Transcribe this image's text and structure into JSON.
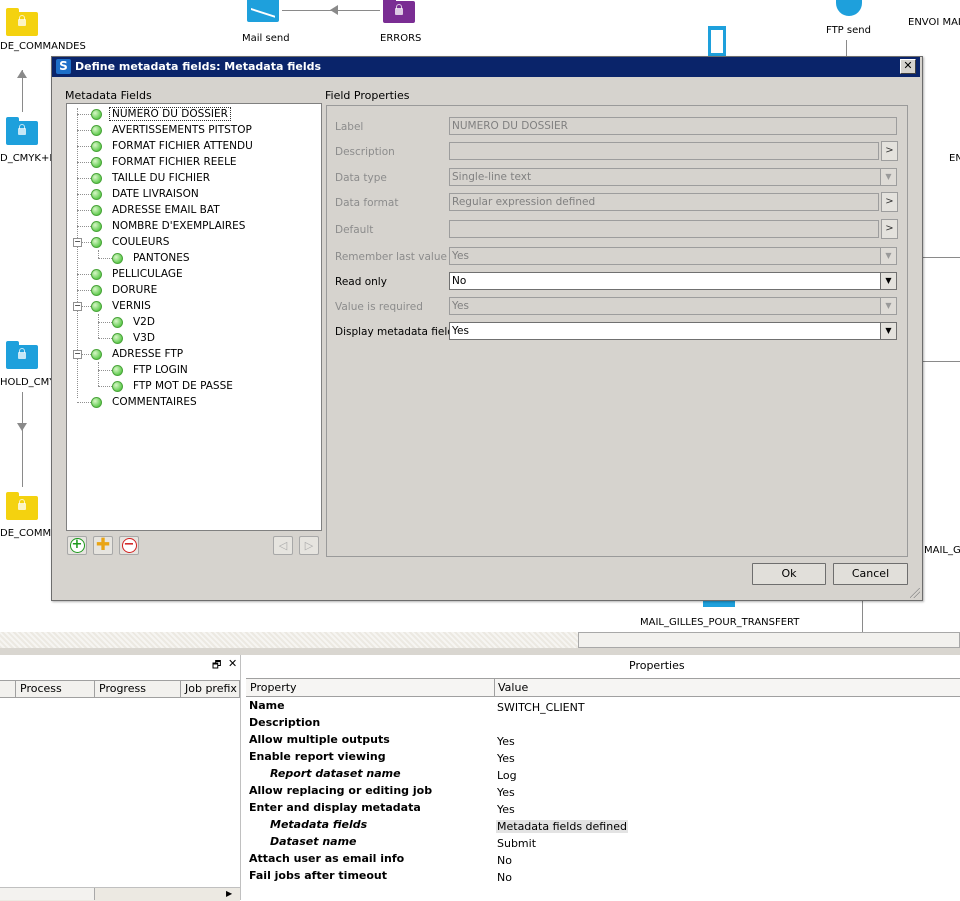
{
  "canvas": {
    "labels": {
      "de_commandes": "DE_COMMANDES",
      "mail_send": "Mail send",
      "errors": "ERRORS",
      "ftp_send": "FTP send",
      "envoi_mai": "ENVOI MAI",
      "d_cmyk": "D_CMYK+I",
      "en": "EN",
      "hold_cmyk": "HOLD_CMYI",
      "de_comm": "DE_COMM",
      "mail_g": "MAIL_G",
      "mail_gilles": "MAIL_GILLES_POUR_TRANSFERT"
    },
    "colors": {
      "folder_yellow": "#f4d20f",
      "folder_blue": "#1ea0dc",
      "folder_purple": "#7a2d93"
    }
  },
  "dialog": {
    "title": "Define metadata fields: Metadata fields",
    "app_icon_letter": "S",
    "close_glyph": "✕",
    "metadata_fields_label": "Metadata Fields",
    "field_properties_label": "Field Properties",
    "tree": [
      {
        "label": "NUMERO DU DOSSIER",
        "selected": true
      },
      {
        "label": "AVERTISSEMENTS PITSTOP"
      },
      {
        "label": "FORMAT FICHIER ATTENDU"
      },
      {
        "label": "FORMAT FICHIER REELE"
      },
      {
        "label": "TAILLE DU FICHIER"
      },
      {
        "label": "DATE LIVRAISON"
      },
      {
        "label": "ADRESSE EMAIL BAT"
      },
      {
        "label": "NOMBRE D'EXEMPLAIRES"
      },
      {
        "label": "COULEURS"
      },
      {
        "label": "PANTONES"
      },
      {
        "label": "PELLICULAGE"
      },
      {
        "label": "DORURE"
      },
      {
        "label": "VERNIS"
      },
      {
        "label": "V2D"
      },
      {
        "label": "V3D"
      },
      {
        "label": "ADRESSE FTP"
      },
      {
        "label": "FTP LOGIN"
      },
      {
        "label": "FTP MOT DE PASSE"
      },
      {
        "label": "COMMENTAIRES"
      }
    ],
    "properties": {
      "label": {
        "name": "Label",
        "value": "NUMERO DU DOSSIER"
      },
      "description": {
        "name": "Description",
        "value": ""
      },
      "data_type": {
        "name": "Data type",
        "value": "Single-line text"
      },
      "data_format": {
        "name": "Data format",
        "value": "Regular expression defined"
      },
      "default": {
        "name": "Default",
        "value": ""
      },
      "remember": {
        "name": "Remember last value",
        "value": "Yes"
      },
      "read_only": {
        "name": "Read only",
        "value": "No"
      },
      "required": {
        "name": "Value is required",
        "value": "Yes"
      },
      "display": {
        "name": "Display metadata field",
        "value": "Yes"
      }
    },
    "more_glyph": ">",
    "dropdown_glyph": "▼",
    "ok_label": "Ok",
    "cancel_label": "Cancel"
  },
  "jobs_panel": {
    "columns": [
      "Process",
      "Progress",
      "Job prefix"
    ],
    "restore_glyph": "🗗",
    "close_glyph": "✕"
  },
  "properties_panel": {
    "title": "Properties",
    "col_property": "Property",
    "col_value": "Value",
    "rows": [
      {
        "name": "Name",
        "value": "SWITCH_CLIENT"
      },
      {
        "name": "Description",
        "value": ""
      },
      {
        "name": "Allow multiple outputs",
        "value": "Yes"
      },
      {
        "name": "Enable report viewing",
        "value": "Yes"
      },
      {
        "name": "Report dataset name",
        "value": "Log",
        "sub": true
      },
      {
        "name": "Allow replacing or editing job",
        "value": "Yes"
      },
      {
        "name": "Enter and display metadata",
        "value": "Yes"
      },
      {
        "name": "Metadata fields",
        "value": "Metadata fields defined",
        "sub": true
      },
      {
        "name": "Dataset name",
        "value": "Submit",
        "sub": true
      },
      {
        "name": "Attach user as email info",
        "value": "No"
      },
      {
        "name": "Fail jobs after timeout",
        "value": "No"
      }
    ]
  }
}
